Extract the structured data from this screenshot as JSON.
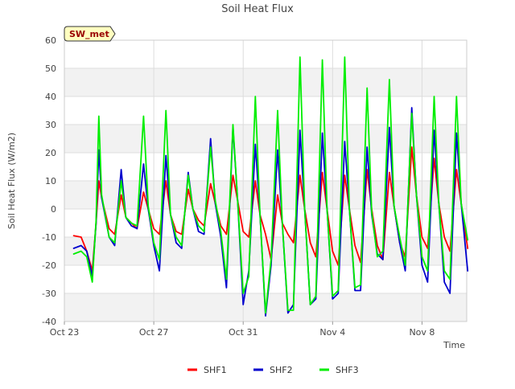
{
  "chart_data": {
    "type": "line",
    "title": "Soil Heat Flux",
    "site_badge": "SW_met",
    "xlabel": "Time",
    "ylabel": "Soil Heat Flux (W/m2)",
    "ylim": [
      -40,
      60
    ],
    "yticks": [
      -40,
      -30,
      -20,
      -10,
      0,
      10,
      20,
      30,
      40,
      50,
      60
    ],
    "xlim": [
      "2023-10-23",
      "2023-11-10"
    ],
    "xticks": [
      {
        "date": "2023-10-23",
        "label": "Oct 23"
      },
      {
        "date": "2023-10-27",
        "label": "Oct 27"
      },
      {
        "date": "2023-10-31",
        "label": "Oct 31"
      },
      {
        "date": "2023-11-04",
        "label": "Nov 4"
      },
      {
        "date": "2023-11-08",
        "label": "Nov 8"
      }
    ],
    "grid": true,
    "legend_position": "bottom",
    "series": [
      {
        "name": "SHF1",
        "color": "#ff0000",
        "x": [
          "2023-10-23T10:00",
          "2023-10-23T18:00",
          "2023-10-24T00:00",
          "2023-10-24T06:00",
          "2023-10-24T10:00",
          "2023-10-24T13:00",
          "2023-10-24T16:00",
          "2023-10-25T00:00",
          "2023-10-25T06:00",
          "2023-10-25T13:00",
          "2023-10-25T18:00",
          "2023-10-26T00:00",
          "2023-10-26T06:00",
          "2023-10-26T13:00",
          "2023-10-26T18:00",
          "2023-10-27T00:00",
          "2023-10-27T06:00",
          "2023-10-27T13:00",
          "2023-10-27T18:00",
          "2023-10-28T00:00",
          "2023-10-28T06:00",
          "2023-10-28T13:00",
          "2023-10-28T18:00",
          "2023-10-29T00:00",
          "2023-10-29T06:00",
          "2023-10-29T13:00",
          "2023-10-29T18:00",
          "2023-10-30T00:00",
          "2023-10-30T06:00",
          "2023-10-30T13:00",
          "2023-10-30T18:00",
          "2023-10-31T00:00",
          "2023-10-31T06:00",
          "2023-10-31T13:00",
          "2023-10-31T18:00",
          "2023-11-01T00:00",
          "2023-11-01T06:00",
          "2023-11-01T13:00",
          "2023-11-01T18:00",
          "2023-11-02T00:00",
          "2023-11-02T06:00",
          "2023-11-02T13:00",
          "2023-11-02T18:00",
          "2023-11-03T00:00",
          "2023-11-03T06:00",
          "2023-11-03T13:00",
          "2023-11-03T18:00",
          "2023-11-04T00:00",
          "2023-11-04T06:00",
          "2023-11-04T13:00",
          "2023-11-04T18:00",
          "2023-11-05T00:00",
          "2023-11-05T06:00",
          "2023-11-05T13:00",
          "2023-11-05T18:00",
          "2023-11-06T00:00",
          "2023-11-06T06:00",
          "2023-11-06T13:00",
          "2023-11-06T18:00",
          "2023-11-07T00:00",
          "2023-11-07T06:00",
          "2023-11-07T13:00",
          "2023-11-07T18:00",
          "2023-11-08T00:00",
          "2023-11-08T06:00",
          "2023-11-08T13:00",
          "2023-11-08T18:00",
          "2023-11-09T00:00",
          "2023-11-09T06:00",
          "2023-11-09T13:00",
          "2023-11-09T18:00",
          "2023-11-10T01:00"
        ],
        "y": [
          -9.5,
          -10,
          -15,
          -22,
          -5,
          10,
          4,
          -7,
          -9,
          5,
          -3,
          -5,
          -7,
          6,
          0,
          -7,
          -9,
          10,
          -2,
          -8,
          -9,
          7,
          0,
          -4,
          -6,
          9,
          2,
          -6,
          -9,
          12,
          3,
          -8,
          -10,
          10,
          -2,
          -9,
          -18,
          5,
          -5,
          -9,
          -12,
          12,
          0,
          -12,
          -17,
          13,
          0,
          -15,
          -20,
          12,
          0,
          -13,
          -19,
          14,
          0,
          -13,
          -18,
          13,
          1,
          -12,
          -17,
          22,
          5,
          -10,
          -14,
          18,
          2,
          -10,
          -15,
          14,
          2,
          -14
        ]
      },
      {
        "name": "SHF2",
        "color": "#0000cd",
        "x": [
          "2023-10-23T10:00",
          "2023-10-23T18:00",
          "2023-10-24T00:00",
          "2023-10-24T06:00",
          "2023-10-24T10:00",
          "2023-10-24T13:00",
          "2023-10-24T16:00",
          "2023-10-25T00:00",
          "2023-10-25T06:00",
          "2023-10-25T13:00",
          "2023-10-25T18:00",
          "2023-10-26T00:00",
          "2023-10-26T06:00",
          "2023-10-26T13:00",
          "2023-10-26T18:00",
          "2023-10-27T00:00",
          "2023-10-27T06:00",
          "2023-10-27T13:00",
          "2023-10-27T18:00",
          "2023-10-28T00:00",
          "2023-10-28T06:00",
          "2023-10-28T13:00",
          "2023-10-28T18:00",
          "2023-10-29T00:00",
          "2023-10-29T06:00",
          "2023-10-29T13:00",
          "2023-10-29T18:00",
          "2023-10-30T00:00",
          "2023-10-30T06:00",
          "2023-10-30T13:00",
          "2023-10-30T18:00",
          "2023-10-31T00:00",
          "2023-10-31T06:00",
          "2023-10-31T13:00",
          "2023-10-31T18:00",
          "2023-11-01T00:00",
          "2023-11-01T06:00",
          "2023-11-01T13:00",
          "2023-11-01T18:00",
          "2023-11-02T00:00",
          "2023-11-02T06:00",
          "2023-11-02T13:00",
          "2023-11-02T18:00",
          "2023-11-03T00:00",
          "2023-11-03T06:00",
          "2023-11-03T13:00",
          "2023-11-03T18:00",
          "2023-11-04T00:00",
          "2023-11-04T06:00",
          "2023-11-04T13:00",
          "2023-11-04T18:00",
          "2023-11-05T00:00",
          "2023-11-05T06:00",
          "2023-11-05T13:00",
          "2023-11-05T18:00",
          "2023-11-06T00:00",
          "2023-11-06T06:00",
          "2023-11-06T13:00",
          "2023-11-06T18:00",
          "2023-11-07T00:00",
          "2023-11-07T06:00",
          "2023-11-07T13:00",
          "2023-11-07T18:00",
          "2023-11-08T00:00",
          "2023-11-08T06:00",
          "2023-11-08T13:00",
          "2023-11-08T18:00",
          "2023-11-09T00:00",
          "2023-11-09T06:00",
          "2023-11-09T13:00",
          "2023-11-09T18:00",
          "2023-11-10T01:00"
        ],
        "y": [
          -14,
          -13,
          -15,
          -24,
          -5,
          21,
          4,
          -10,
          -13,
          14,
          -3,
          -6,
          -7,
          16,
          0,
          -13,
          -22,
          19,
          -2,
          -12,
          -14,
          13,
          0,
          -8,
          -9,
          25,
          2,
          -10,
          -28,
          29,
          3,
          -34,
          -22,
          23,
          -2,
          -38,
          -20,
          21,
          -5,
          -37,
          -34,
          28,
          0,
          -34,
          -32,
          27,
          0,
          -32,
          -30,
          24,
          0,
          -29,
          -29,
          22,
          -2,
          -16,
          -18,
          29,
          1,
          -12,
          -22,
          36,
          5,
          -20,
          -26,
          28,
          2,
          -26,
          -30,
          27,
          2,
          -22
        ]
      },
      {
        "name": "SHF3",
        "color": "#00ee00",
        "x": [
          "2023-10-23T10:00",
          "2023-10-23T18:00",
          "2023-10-24T00:00",
          "2023-10-24T06:00",
          "2023-10-24T10:00",
          "2023-10-24T13:00",
          "2023-10-24T16:00",
          "2023-10-25T00:00",
          "2023-10-25T06:00",
          "2023-10-25T13:00",
          "2023-10-25T18:00",
          "2023-10-26T00:00",
          "2023-10-26T06:00",
          "2023-10-26T13:00",
          "2023-10-26T18:00",
          "2023-10-27T00:00",
          "2023-10-27T06:00",
          "2023-10-27T13:00",
          "2023-10-27T18:00",
          "2023-10-28T00:00",
          "2023-10-28T06:00",
          "2023-10-28T13:00",
          "2023-10-28T18:00",
          "2023-10-29T00:00",
          "2023-10-29T06:00",
          "2023-10-29T13:00",
          "2023-10-29T18:00",
          "2023-10-30T00:00",
          "2023-10-30T06:00",
          "2023-10-30T13:00",
          "2023-10-30T18:00",
          "2023-10-31T00:00",
          "2023-10-31T06:00",
          "2023-10-31T13:00",
          "2023-10-31T18:00",
          "2023-11-01T00:00",
          "2023-11-01T06:00",
          "2023-11-01T13:00",
          "2023-11-01T18:00",
          "2023-11-02T00:00",
          "2023-11-02T06:00",
          "2023-11-02T13:00",
          "2023-11-02T18:00",
          "2023-11-03T00:00",
          "2023-11-03T06:00",
          "2023-11-03T13:00",
          "2023-11-03T18:00",
          "2023-11-04T00:00",
          "2023-11-04T06:00",
          "2023-11-04T13:00",
          "2023-11-04T18:00",
          "2023-11-05T00:00",
          "2023-11-05T06:00",
          "2023-11-05T13:00",
          "2023-11-05T18:00",
          "2023-11-06T00:00",
          "2023-11-06T06:00",
          "2023-11-06T13:00",
          "2023-11-06T18:00",
          "2023-11-07T00:00",
          "2023-11-07T06:00",
          "2023-11-07T13:00",
          "2023-11-07T18:00",
          "2023-11-08T00:00",
          "2023-11-08T06:00",
          "2023-11-08T13:00",
          "2023-11-08T18:00",
          "2023-11-09T00:00",
          "2023-11-09T06:00",
          "2023-11-09T13:00",
          "2023-11-09T18:00",
          "2023-11-10T01:00"
        ],
        "y": [
          -16,
          -15,
          -17,
          -26,
          -4,
          33,
          5,
          -10,
          -12,
          10,
          -3,
          -5,
          -6,
          33,
          1,
          -12,
          -18,
          35,
          -2,
          -10,
          -13,
          12,
          0,
          -6,
          -8,
          22,
          3,
          -8,
          -25,
          30,
          3,
          -30,
          -24,
          40,
          -2,
          -37,
          -18,
          35,
          -5,
          -36,
          -36,
          54,
          0,
          -34,
          -31,
          53,
          0,
          -31,
          -29,
          54,
          0,
          -28,
          -27,
          43,
          -1,
          -17,
          -15,
          46,
          1,
          -10,
          -20,
          34,
          5,
          -17,
          -22,
          40,
          2,
          -22,
          -25,
          40,
          2,
          -11
        ]
      }
    ]
  }
}
